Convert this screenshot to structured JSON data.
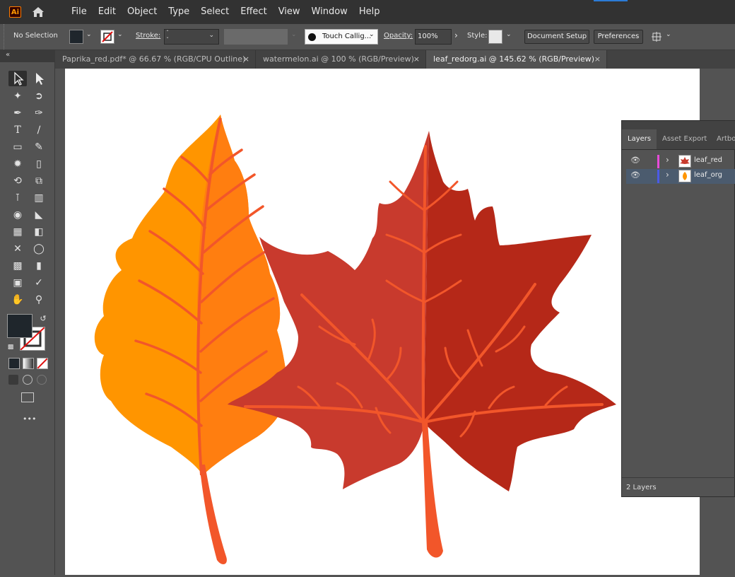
{
  "app": {
    "logo_text": "Ai"
  },
  "menu": [
    "File",
    "Edit",
    "Object",
    "Type",
    "Select",
    "Effect",
    "View",
    "Window",
    "Help"
  ],
  "control_bar": {
    "selection_label": "No Selection",
    "stroke_label": "Stroke:",
    "brush_name": "Touch Callig...",
    "opacity_label": "Opacity:",
    "opacity_value": "100%",
    "style_label": "Style:",
    "document_setup": "Document Setup",
    "preferences": "Preferences"
  },
  "tabs": [
    {
      "label": "Paprika_red.pdf* @ 66.67 % (RGB/CPU Outline)",
      "active": false
    },
    {
      "label": "watermelon.ai @ 100 % (RGB/Preview)",
      "active": false
    },
    {
      "label": "leaf_redorg.ai @ 145.62 % (RGB/Preview)",
      "active": true
    }
  ],
  "tab_close_glyph": "×",
  "layers_panel": {
    "tabs": [
      "Layers",
      "Asset Export",
      "Artbo"
    ],
    "layers": [
      {
        "name": "leaf_red",
        "color": "#e64bd9",
        "selected": false
      },
      {
        "name": "leaf_org",
        "color": "#4b5ae6",
        "selected": true
      }
    ],
    "footer": "2 Layers"
  },
  "colors": {
    "leaf_orange": "#ff9500",
    "leaf_orange_dark": "#ff7a10",
    "leaf_red": "#c83a2d",
    "leaf_red_dark": "#b52818",
    "vein": "#f2562a",
    "fill_swatch": "#1f262c"
  },
  "more_tools": "•••"
}
